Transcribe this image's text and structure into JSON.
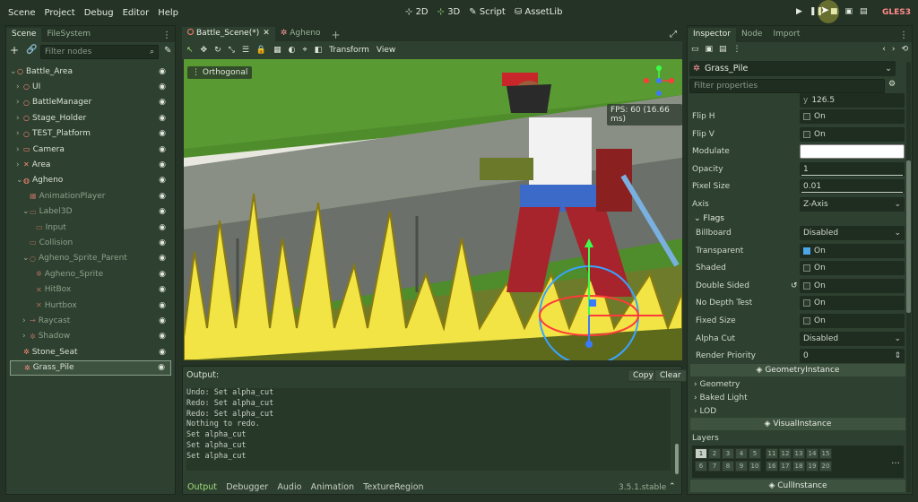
{
  "menu": [
    "Scene",
    "Project",
    "Debug",
    "Editor",
    "Help"
  ],
  "main_screens": [
    {
      "label": "2D",
      "active": false
    },
    {
      "label": "3D",
      "active": true
    },
    {
      "label": "Script",
      "active": false
    },
    {
      "label": "AssetLib",
      "active": false
    }
  ],
  "renderer": "GLES3",
  "scene_dock": {
    "tabs": [
      "Scene",
      "FileSystem"
    ],
    "filter_placeholder": "Filter nodes",
    "nodes": [
      {
        "label": "Battle_Area",
        "depth": 0,
        "icon": "node3d-icon",
        "dim": false
      },
      {
        "label": "UI",
        "depth": 1,
        "icon": "node3d-icon",
        "dim": false
      },
      {
        "label": "BattleManager",
        "depth": 1,
        "icon": "node3d-icon",
        "dim": false
      },
      {
        "label": "Stage_Holder",
        "depth": 1,
        "icon": "node3d-icon",
        "dim": false
      },
      {
        "label": "TEST_Platform",
        "depth": 1,
        "icon": "node3d-icon",
        "dim": false
      },
      {
        "label": "Camera",
        "depth": 1,
        "icon": "camera-icon",
        "dim": false
      },
      {
        "label": "Area",
        "depth": 1,
        "icon": "area-icon",
        "dim": false
      },
      {
        "label": "Agheno",
        "depth": 1,
        "icon": "kinematic-icon",
        "dim": false
      },
      {
        "label": "AnimationPlayer",
        "depth": 2,
        "icon": "animation-player-icon",
        "dim": true
      },
      {
        "label": "Label3D",
        "depth": 2,
        "icon": "label3d-icon",
        "dim": true
      },
      {
        "label": "Input",
        "depth": 3,
        "icon": "input-icon",
        "dim": true
      },
      {
        "label": "Collision",
        "depth": 2,
        "icon": "collision-icon",
        "dim": true
      },
      {
        "label": "Agheno_Sprite_Parent",
        "depth": 2,
        "icon": "node3d-icon",
        "dim": true
      },
      {
        "label": "Agheno_Sprite",
        "depth": 3,
        "icon": "sprite3d-icon",
        "dim": true
      },
      {
        "label": "HitBox",
        "depth": 3,
        "icon": "area-icon",
        "dim": true
      },
      {
        "label": "Hurtbox",
        "depth": 3,
        "icon": "area-icon",
        "dim": true
      },
      {
        "label": "Raycast",
        "depth": 2,
        "icon": "raycast-icon",
        "dim": true
      },
      {
        "label": "Shadow",
        "depth": 2,
        "icon": "sprite3d-icon",
        "dim": true
      },
      {
        "label": "Stone_Seat",
        "depth": 1,
        "icon": "sprite3d-icon",
        "dim": false
      },
      {
        "label": "Grass_Pile",
        "depth": 1,
        "icon": "sprite3d-icon",
        "dim": false
      }
    ]
  },
  "editor_tabs": [
    {
      "label": "Battle_Scene(*)",
      "active": true
    },
    {
      "label": "Agheno",
      "active": false
    }
  ],
  "viewport": {
    "menus": [
      "Transform",
      "View"
    ],
    "perspective": "Orthogonal",
    "fps": "FPS: 60 (16.66 ms)"
  },
  "output": {
    "title": "Output:",
    "copy_label": "Copy",
    "clear_label": "Clear",
    "lines": [
      "Undo: Set alpha_cut",
      "Redo: Set alpha_cut",
      "Redo: Set alpha_cut",
      "Nothing to redo.",
      "Set alpha_cut",
      "Set alpha_cut",
      "Set alpha_cut"
    ]
  },
  "bottom_tabs": [
    {
      "label": "Output",
      "active": true
    },
    {
      "label": "Debugger",
      "active": false
    },
    {
      "label": "Audio",
      "active": false
    },
    {
      "label": "Animation",
      "active": false
    },
    {
      "label": "TextureRegion",
      "active": false
    }
  ],
  "version": "3.5.1.stable",
  "inspector": {
    "tabs": [
      "Inspector",
      "Node",
      "Import"
    ],
    "object_name": "Grass_Pile",
    "filter_placeholder": "Filter properties",
    "y_label": "y",
    "y_value": "126.5",
    "props": [
      {
        "label": "Flip H",
        "type": "check",
        "checked": false,
        "text": "On"
      },
      {
        "label": "Flip V",
        "type": "check",
        "checked": false,
        "text": "On"
      },
      {
        "label": "Modulate",
        "type": "color",
        "color": "#ffffff"
      },
      {
        "label": "Opacity",
        "type": "slider",
        "text": "1"
      },
      {
        "label": "Pixel Size",
        "type": "slider",
        "text": "0.01"
      },
      {
        "label": "Axis",
        "type": "select",
        "text": "Z-Axis"
      }
    ],
    "flags_label": "Flags",
    "flags": [
      {
        "label": "Billboard",
        "type": "select",
        "text": "Disabled"
      },
      {
        "label": "Transparent",
        "type": "check",
        "checked": true,
        "text": "On"
      },
      {
        "label": "Shaded",
        "type": "check",
        "checked": false,
        "text": "On"
      },
      {
        "label": "Double Sided",
        "type": "check",
        "checked": false,
        "text": "On",
        "revert": true
      },
      {
        "label": "No Depth Test",
        "type": "check",
        "checked": false,
        "text": "On"
      },
      {
        "label": "Fixed Size",
        "type": "check",
        "checked": false,
        "text": "On"
      },
      {
        "label": "Alpha Cut",
        "type": "select",
        "text": "Disabled"
      },
      {
        "label": "Render Priority",
        "type": "spin",
        "text": "0"
      }
    ],
    "geometry_instance_label": "GeometryInstance",
    "collapsed_sections": [
      "Geometry",
      "Baked Light",
      "LOD"
    ],
    "visual_instance_label": "VisualInstance",
    "layers_label": "Layers",
    "layers_row1": [
      "1",
      "2",
      "3",
      "4",
      "5",
      "11",
      "12",
      "13",
      "14",
      "15"
    ],
    "layers_row2": [
      "6",
      "7",
      "8",
      "9",
      "10",
      "16",
      "17",
      "18",
      "19",
      "20"
    ],
    "layers_on": [
      "1"
    ],
    "cull_instance_label": "CullInstance"
  }
}
